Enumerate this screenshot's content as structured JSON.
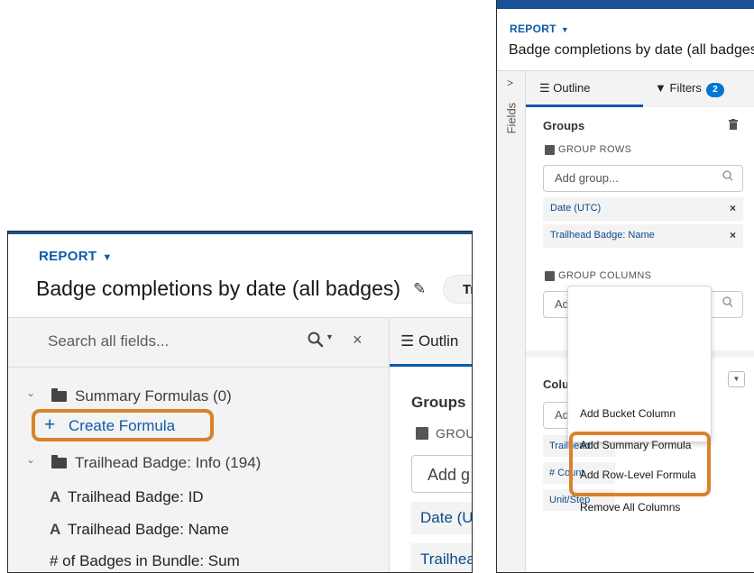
{
  "left_panel": {
    "report_label": "REPORT",
    "report_caret": "▼",
    "report_title": "Badge completions by date (all badges)",
    "pencil_glyph": "✎",
    "pill_text": "Tr",
    "search": {
      "placeholder": "Search all fields...",
      "icon": "search-icon",
      "caret": "▼",
      "close": "×"
    },
    "tree_chevron": "⌄",
    "summary_folder_label": "Summary Formulas (0)",
    "create_formula": {
      "plus": "+",
      "label": "Create Formula"
    },
    "badge_folder_label": "Trailhead Badge: Info (194)",
    "field_type_glyph": "A",
    "fields": [
      "Trailhead Badge: ID",
      "Trailhead Badge: Name",
      "# of Badges in Bundle: Sum"
    ],
    "outline_tab": "☰ Outlin",
    "groups_label": "Groups",
    "group_rows_label": "GROU",
    "add_group_placeholder": "Add g",
    "chips": [
      "Date (U",
      "Trailhea"
    ]
  },
  "right_panel": {
    "report_label": "REPORT",
    "report_caret": "▼",
    "report_title": "Badge completions by date (all badges)",
    "rail_chevron": ">",
    "rail_label": "Fields",
    "tabs": {
      "outline": "☰ Outline",
      "filters": "Filters",
      "filters_icon": "▼",
      "filters_count": "2"
    },
    "groups": {
      "label": "Groups",
      "trash_glyph": "🗑",
      "rows_label": "GROUP ROWS",
      "rows_placeholder": "Add group...",
      "search_glyph": "⚲",
      "row_chips": [
        {
          "label": "Date (UTC)",
          "remove": "×"
        },
        {
          "label": "Trailhead Badge: Name",
          "remove": "×"
        }
      ],
      "columns_label": "GROUP COLUMNS",
      "columns_placeholder": "Add group..."
    },
    "columns": {
      "label": "Columns",
      "dropdown_glyph": "▼",
      "input_placeholder": "Add col",
      "chips": [
        "Trailhead",
        "# Count",
        "Unit/Step"
      ],
      "menu": [
        "Add Bucket Column",
        "Add Summary Formula",
        "Add Row-Level Formula",
        "Remove All Columns"
      ]
    }
  },
  "colors": {
    "brand_blue": "#0b5cab",
    "header_bar": "#1b5297",
    "highlight_orange": "#d9822b",
    "panel_gray": "#f3f3f3"
  }
}
